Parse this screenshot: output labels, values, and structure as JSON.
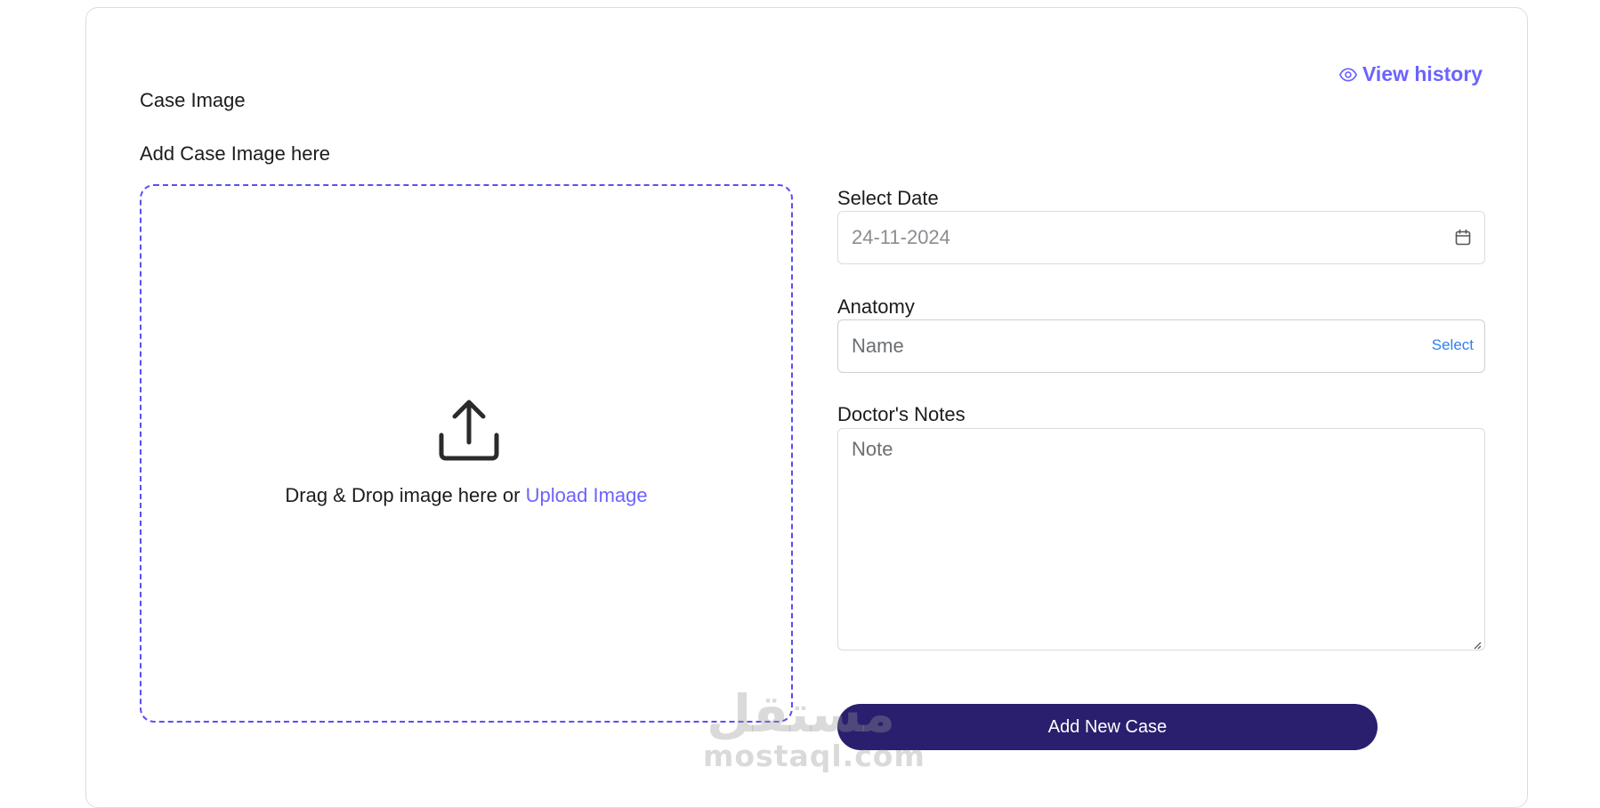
{
  "header": {
    "history_link": {
      "label": "View history",
      "icon": "eye-icon"
    }
  },
  "case_image": {
    "title": "Case Image",
    "subtitle": "Add Case Image here",
    "dropzone": {
      "icon": "upload-icon",
      "prompt": "Drag & Drop image here or",
      "upload_label": "Upload Image"
    }
  },
  "form": {
    "date": {
      "label": "Select Date",
      "value": "24-11-2024",
      "icon": "calendar-icon"
    },
    "anatomy": {
      "label": "Anatomy",
      "placeholder": "Name",
      "select_label": "Select"
    },
    "notes": {
      "label": "Doctor's Notes",
      "placeholder": "Note"
    },
    "submit_label": "Add New Case"
  },
  "watermark": {
    "arabic": "مستقل",
    "latin": "mostaql.com"
  },
  "colors": {
    "accent": "#6c63ff",
    "dropzone_border": "#5a4ff3",
    "button_bg": "#2a1f6e",
    "select_link": "#2f80ed"
  }
}
